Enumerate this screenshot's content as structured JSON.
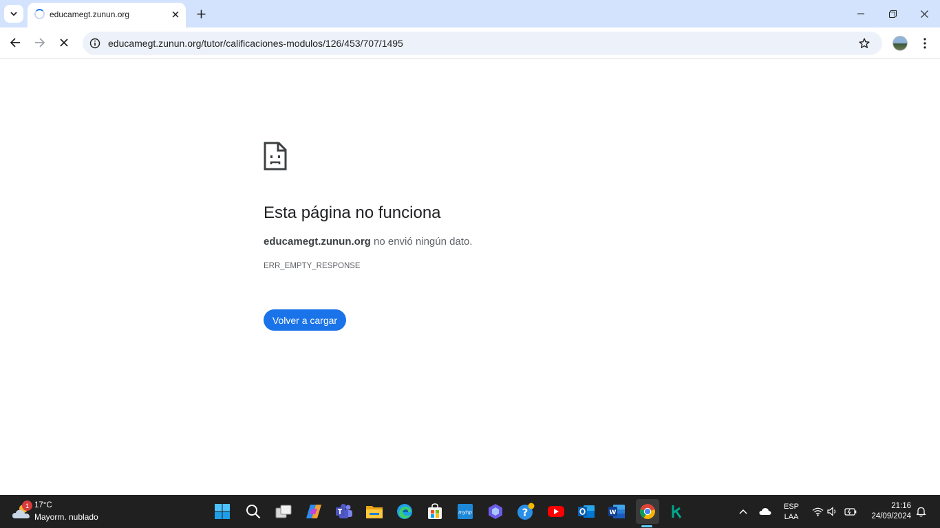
{
  "browser": {
    "tab": {
      "title": "educamegt.zunun.org"
    },
    "address_bar": {
      "url": "educamegt.zunun.org/tutor/calificaciones-modulos/126/453/707/1495"
    }
  },
  "error_page": {
    "title": "Esta página no funciona",
    "host": "educamegt.zunun.org",
    "message": " no envió ningún dato.",
    "error_code": "ERR_EMPTY_RESPONSE",
    "reload_label": "Volver a cargar"
  },
  "taskbar": {
    "weather": {
      "badge": "1",
      "temperature": "17°C",
      "condition": "Mayorm. nublado"
    },
    "language": {
      "line1": "ESP",
      "line2": "LAA"
    },
    "clock": {
      "time": "21:16",
      "date": "24/09/2024"
    },
    "apps": [
      "start",
      "search",
      "task-view",
      "copilot",
      "teams",
      "file-explorer",
      "edge",
      "store",
      "myhp",
      "copilot-alt",
      "tips",
      "youtube",
      "outlook",
      "word",
      "chrome",
      "kaspersky"
    ]
  },
  "colors": {
    "accent": "#1a73e8",
    "tabstrip": "#d3e3fd",
    "taskbar": "#202020"
  }
}
